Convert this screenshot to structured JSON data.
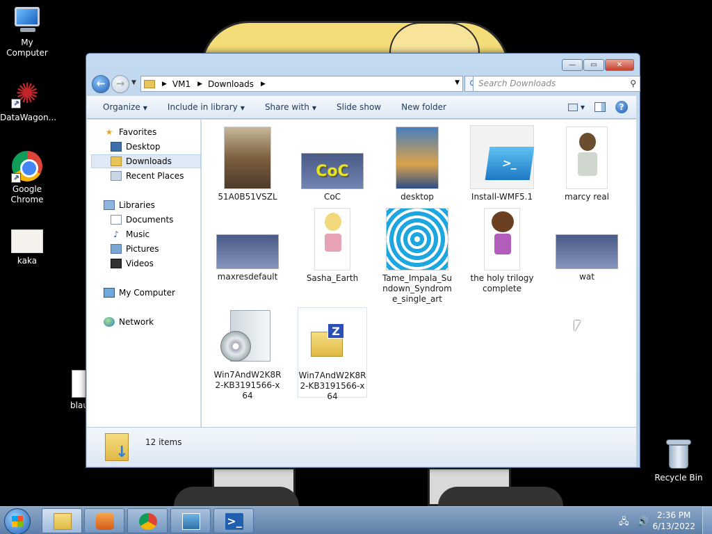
{
  "desktop": {
    "icons": [
      {
        "label": "My Computer"
      },
      {
        "label": "DataWagon..."
      },
      {
        "label": "Google Chrome"
      },
      {
        "label": "kaka"
      },
      {
        "label": "blau"
      },
      {
        "label": "Recycle Bin"
      }
    ]
  },
  "window": {
    "controls": {
      "minimize": "—",
      "maximize": "▭",
      "close": "✕"
    },
    "breadcrumb": [
      "VM1",
      "Downloads"
    ],
    "search_placeholder": "Search Downloads",
    "toolbar": [
      {
        "label": "Organize"
      },
      {
        "label": "Include in library"
      },
      {
        "label": "Share with"
      },
      {
        "label": "Slide show"
      },
      {
        "label": "New folder"
      }
    ],
    "help_label": "?",
    "nav": {
      "favorites": "Favorites",
      "desktop": "Desktop",
      "downloads": "Downloads",
      "recent": "Recent Places",
      "libraries": "Libraries",
      "documents": "Documents",
      "music": "Music",
      "pictures": "Pictures",
      "videos": "Videos",
      "computer": "My Computer",
      "network": "Network"
    },
    "files": [
      {
        "name": "51A0B51VSZL"
      },
      {
        "name": "CoC",
        "thumb_text": "CoC"
      },
      {
        "name": "desktop"
      },
      {
        "name": "Install-WMF5.1"
      },
      {
        "name": "marcy real"
      },
      {
        "name": "maxresdefault"
      },
      {
        "name": "Sasha_Earth"
      },
      {
        "name": "Tame_Impala_Sundown_Syndrome_single_art"
      },
      {
        "name": "the holy trilogy complete"
      },
      {
        "name": "wat"
      },
      {
        "name": "Win7AndW2K8R2-KB3191566-x64"
      },
      {
        "name": "Win7AndW2K8R2-KB3191566-x64"
      }
    ],
    "status": {
      "item_count": "12 items"
    }
  },
  "taskbar": {
    "clock_time": "2:36 PM",
    "clock_date": "6/13/2022"
  }
}
